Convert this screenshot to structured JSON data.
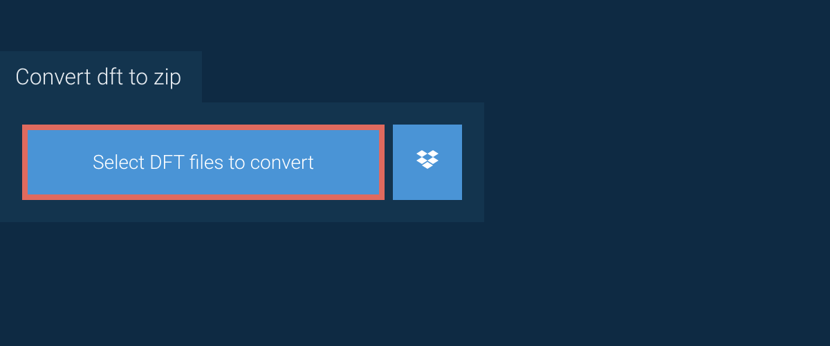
{
  "tab": {
    "label": "Convert dft to zip"
  },
  "actions": {
    "select_button_label": "Select DFT files to convert"
  },
  "colors": {
    "background": "#0e2a43",
    "panel": "#13344e",
    "button": "#4a94d6",
    "button_border": "#e06a5e",
    "text_light": "#ffffff"
  }
}
